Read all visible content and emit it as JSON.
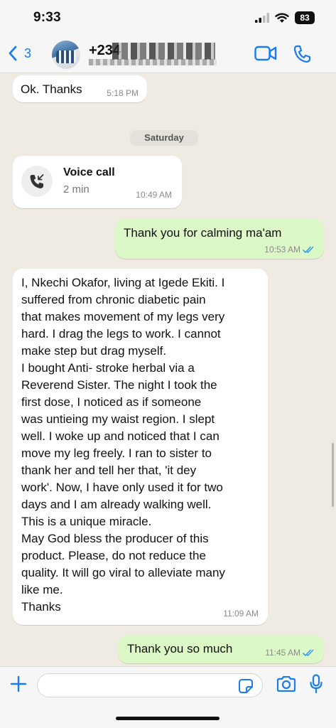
{
  "status": {
    "time": "9:33",
    "battery": "83"
  },
  "header": {
    "back_count": "3",
    "contact_prefix": "+234"
  },
  "date_separator": "Saturday",
  "messages": [
    {
      "dir": "in",
      "text": "Ok. Thanks",
      "time": "5:18 PM"
    },
    {
      "type": "voice-call",
      "title": "Voice call",
      "duration": "2 min",
      "time": "10:49 AM"
    },
    {
      "dir": "out",
      "text": "Thank you for calming ma'am",
      "time": "10:53 AM",
      "read": true
    },
    {
      "dir": "in",
      "time": "11:09 AM",
      "lines": [
        "I, Nkechi Okafor, living at Igede Ekiti. I",
        "suffered from chronic  diabetic pain",
        "that makes movement of my legs very",
        "hard. I drag the legs to work. I cannot",
        "make step but drag myself.",
        "I bought Anti- stroke herbal via a",
        "Reverend Sister. The night I took the",
        "first dose,  I noticed as if someone",
        "was untieing my waist region. I slept",
        "well. I woke up and noticed that I can",
        "move my leg freely. I ran to sister to",
        "thank her and tell her that, 'it dey",
        "work'. Now, I have only used it for two",
        "days and I am already walking well.",
        "This is a unique miracle.",
        "May God bless the producer of this",
        "product. Please, do not reduce the",
        "quality. It will go viral to alleviate many",
        "like me.",
        "Thanks"
      ]
    },
    {
      "dir": "out",
      "text": "Thank you so much",
      "time": "11:45 AM",
      "read": true
    }
  ],
  "composer": {
    "placeholder": ""
  },
  "colors": {
    "accent": "#1a7cf0",
    "outgoing_bubble": "#dcf8c6",
    "read_ticks": "#3a9bea",
    "chat_background": "#efeae2"
  },
  "icons": [
    "back-chevron-icon",
    "video-call-icon",
    "phone-icon",
    "missed-call-icon",
    "plus-icon",
    "sticker-icon",
    "camera-icon",
    "microphone-icon",
    "double-check-icon",
    "signal-icon",
    "wifi-icon"
  ]
}
